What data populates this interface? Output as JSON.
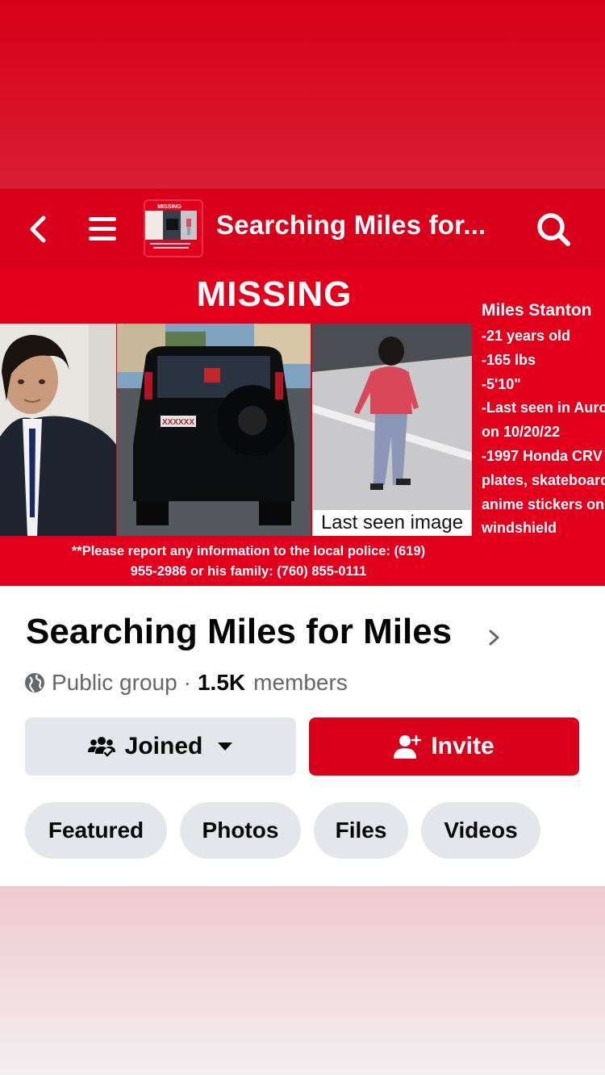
{
  "nav": {
    "title": "Searching Miles for...",
    "thumb_caption": "MISSING"
  },
  "cover": {
    "headline": "MISSING",
    "last_seen_label": "Last seen image",
    "details": [
      "Miles Stanton",
      "-21 years old",
      "-165 lbs",
      "-5'10\"",
      "-Last seen in Aurora",
      "on 10/20/22",
      "-1997 Honda CRV",
      "plates, skateboard",
      "anime stickers on",
      "windshield"
    ],
    "report_line1": "**Please report any information to the local police: (619)",
    "report_line2": "955-2986 or his family: (760) 855-0111",
    "plate_text": "XXXXXX"
  },
  "group": {
    "name": "Searching Miles for Miles",
    "privacy": "Public group",
    "separator": "·",
    "member_count": "1.5K",
    "members_label": "members"
  },
  "actions": {
    "joined_label": "Joined",
    "invite_label": "Invite"
  },
  "chips": [
    {
      "label": "Featured"
    },
    {
      "label": "Photos"
    },
    {
      "label": "Files"
    },
    {
      "label": "Videos"
    }
  ],
  "colors": {
    "brand_red": "#d9001b",
    "chip_gray": "#e4e6eb",
    "text_primary": "#050505",
    "text_secondary": "#65676b"
  }
}
